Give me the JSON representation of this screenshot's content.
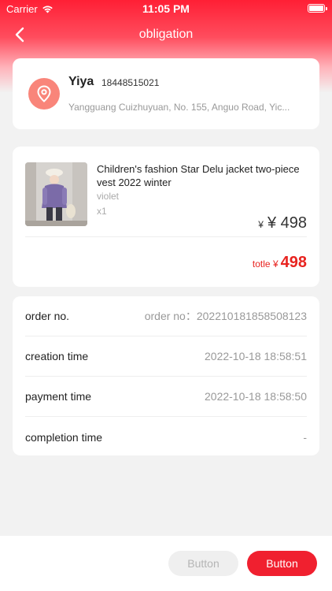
{
  "status_bar": {
    "carrier": "Carrier",
    "time": "11:05 PM"
  },
  "nav": {
    "title": "obligation",
    "back_icon": "chevron-left-icon"
  },
  "address": {
    "name": "Yiya",
    "phone": "18448515021",
    "line": "Yangguang Cuizhuyuan, No. 155, Anguo Road, Yic...",
    "icon": "location-pin-icon"
  },
  "product": {
    "name": "Children's fashion Star Delu jacket two-piece vest 2022 winter",
    "variant": "violet",
    "quantity": "x1",
    "price_prefix": "¥",
    "price": "¥ 498",
    "total_label": "totle ¥",
    "total_value": "498"
  },
  "order_info": {
    "rows": [
      {
        "label": "order no.",
        "value": "order no：202210181858508123"
      },
      {
        "label": "creation time",
        "value": "2022-10-18 18:58:51"
      },
      {
        "label": "payment time",
        "value": "2022-10-18 18:58:50"
      },
      {
        "label": "completion time",
        "value": "-"
      }
    ]
  },
  "actions": {
    "secondary_label": "Button",
    "primary_label": "Button"
  },
  "colors": {
    "accent": "#f0202f",
    "total_text": "#e8231f",
    "pin_bg": "#f9857a"
  }
}
